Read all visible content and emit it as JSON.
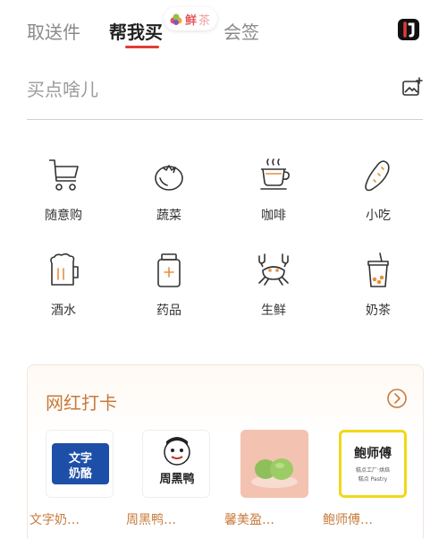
{
  "tabs": {
    "send": "取送件",
    "buy": "帮我买",
    "member": "会签"
  },
  "fresh_badge": {
    "part1": "鲜",
    "part2": "茶"
  },
  "brand_logo_text": "8J",
  "search": {
    "placeholder": "买点啥儿"
  },
  "categories": [
    {
      "label": "随意购",
      "icon": "cart-icon"
    },
    {
      "label": "蔬菜",
      "icon": "tomato-icon"
    },
    {
      "label": "咖啡",
      "icon": "coffee-icon"
    },
    {
      "label": "小吃",
      "icon": "snack-icon"
    },
    {
      "label": "酒水",
      "icon": "beer-icon"
    },
    {
      "label": "药品",
      "icon": "medicine-icon"
    },
    {
      "label": "生鲜",
      "icon": "crab-icon"
    },
    {
      "label": "奶茶",
      "icon": "milk-tea-icon"
    }
  ],
  "featured": {
    "title": "网红打卡",
    "items": [
      {
        "name": "文字奶…",
        "logo_text_1": "文字",
        "logo_text_2": "奶酪"
      },
      {
        "name": "周黑鸭…",
        "logo_text": "周黑鸭"
      },
      {
        "name": "馨美盈…"
      },
      {
        "name": "鲍师傅…",
        "logo_text": "鲍师傅",
        "logo_sub_1": "糕点工厂·烘焙",
        "logo_sub_2": "糕点 Pastry"
      }
    ]
  },
  "colors": {
    "accent_red": "#e23a3a",
    "card_title": "#c87a3a",
    "muted": "#8a8a8a"
  }
}
